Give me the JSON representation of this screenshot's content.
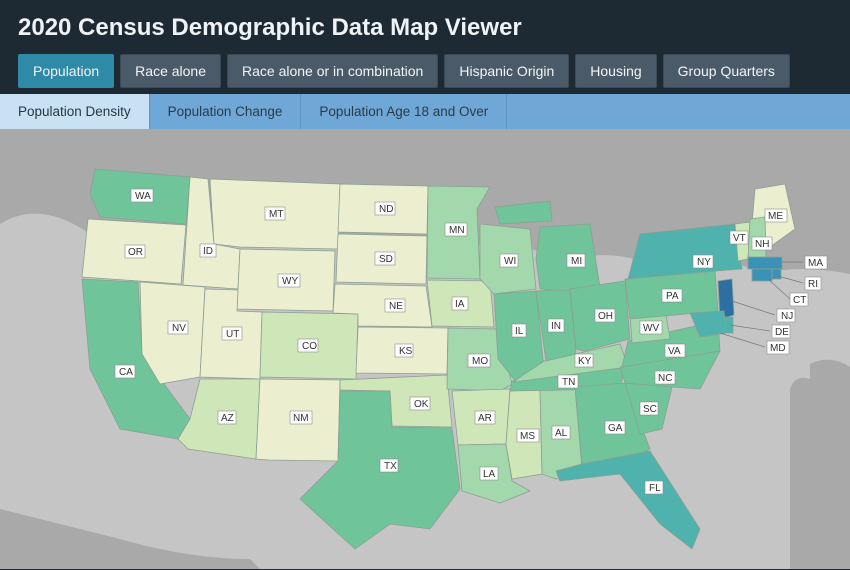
{
  "header": {
    "title": "2020 Census Demographic Data Map Viewer"
  },
  "tabs_primary": [
    {
      "label": "Population",
      "active": true
    },
    {
      "label": "Race alone",
      "active": false
    },
    {
      "label": "Race alone or in combination",
      "active": false
    },
    {
      "label": "Hispanic Origin",
      "active": false
    },
    {
      "label": "Housing",
      "active": false
    },
    {
      "label": "Group Quarters",
      "active": false
    }
  ],
  "tabs_secondary": [
    {
      "label": "Population Density",
      "active": true
    },
    {
      "label": "Population Change",
      "active": false
    },
    {
      "label": "Population Age 18 and Over",
      "active": false
    }
  ],
  "legend_colors": {
    "c1": "#ecefcf",
    "c2": "#cfe6b9",
    "c3": "#a3d7ac",
    "c4": "#6fc49a",
    "c5": "#4fb2ad",
    "c6": "#3b92b8",
    "c7": "#2e6fa3"
  },
  "states": {
    "WA": {
      "abbr": "WA",
      "tier": "c4"
    },
    "OR": {
      "abbr": "OR",
      "tier": "c1"
    },
    "CA": {
      "abbr": "CA",
      "tier": "c4"
    },
    "NV": {
      "abbr": "NV",
      "tier": "c1"
    },
    "ID": {
      "abbr": "ID",
      "tier": "c1"
    },
    "MT": {
      "abbr": "MT",
      "tier": "c1"
    },
    "WY": {
      "abbr": "WY",
      "tier": "c1"
    },
    "UT": {
      "abbr": "UT",
      "tier": "c1"
    },
    "CO": {
      "abbr": "CO",
      "tier": "c2"
    },
    "AZ": {
      "abbr": "AZ",
      "tier": "c2"
    },
    "NM": {
      "abbr": "NM",
      "tier": "c1"
    },
    "ND": {
      "abbr": "ND",
      "tier": "c1"
    },
    "SD": {
      "abbr": "SD",
      "tier": "c1"
    },
    "NE": {
      "abbr": "NE",
      "tier": "c1"
    },
    "KS": {
      "abbr": "KS",
      "tier": "c1"
    },
    "OK": {
      "abbr": "OK",
      "tier": "c2"
    },
    "TX": {
      "abbr": "TX",
      "tier": "c4"
    },
    "MN": {
      "abbr": "MN",
      "tier": "c3"
    },
    "IA": {
      "abbr": "IA",
      "tier": "c2"
    },
    "MO": {
      "abbr": "MO",
      "tier": "c3"
    },
    "AR": {
      "abbr": "AR",
      "tier": "c2"
    },
    "LA": {
      "abbr": "LA",
      "tier": "c3"
    },
    "WI": {
      "abbr": "WI",
      "tier": "c3"
    },
    "IL": {
      "abbr": "IL",
      "tier": "c4"
    },
    "MS": {
      "abbr": "MS",
      "tier": "c2"
    },
    "AL": {
      "abbr": "AL",
      "tier": "c3"
    },
    "TN": {
      "abbr": "TN",
      "tier": "c4"
    },
    "KY": {
      "abbr": "KY",
      "tier": "c3"
    },
    "IN": {
      "abbr": "IN",
      "tier": "c4"
    },
    "MI": {
      "abbr": "MI",
      "tier": "c4"
    },
    "OH": {
      "abbr": "OH",
      "tier": "c4"
    },
    "GA": {
      "abbr": "GA",
      "tier": "c4"
    },
    "FL": {
      "abbr": "FL",
      "tier": "c5"
    },
    "SC": {
      "abbr": "SC",
      "tier": "c4"
    },
    "NC": {
      "abbr": "NC",
      "tier": "c4"
    },
    "VA": {
      "abbr": "VA",
      "tier": "c4"
    },
    "WV": {
      "abbr": "WV",
      "tier": "c3"
    },
    "PA": {
      "abbr": "PA",
      "tier": "c4"
    },
    "NY": {
      "abbr": "NY",
      "tier": "c5"
    },
    "ME": {
      "abbr": "ME",
      "tier": "c1"
    },
    "VT": {
      "abbr": "VT",
      "tier": "c2"
    },
    "NH": {
      "abbr": "NH",
      "tier": "c3"
    },
    "MA": {
      "abbr": "MA",
      "tier": "c6"
    },
    "RI": {
      "abbr": "RI",
      "tier": "c6"
    },
    "CT": {
      "abbr": "CT",
      "tier": "c6"
    },
    "NJ": {
      "abbr": "NJ",
      "tier": "c7"
    },
    "DE": {
      "abbr": "DE",
      "tier": "c5"
    },
    "MD": {
      "abbr": "MD",
      "tier": "c5"
    }
  }
}
